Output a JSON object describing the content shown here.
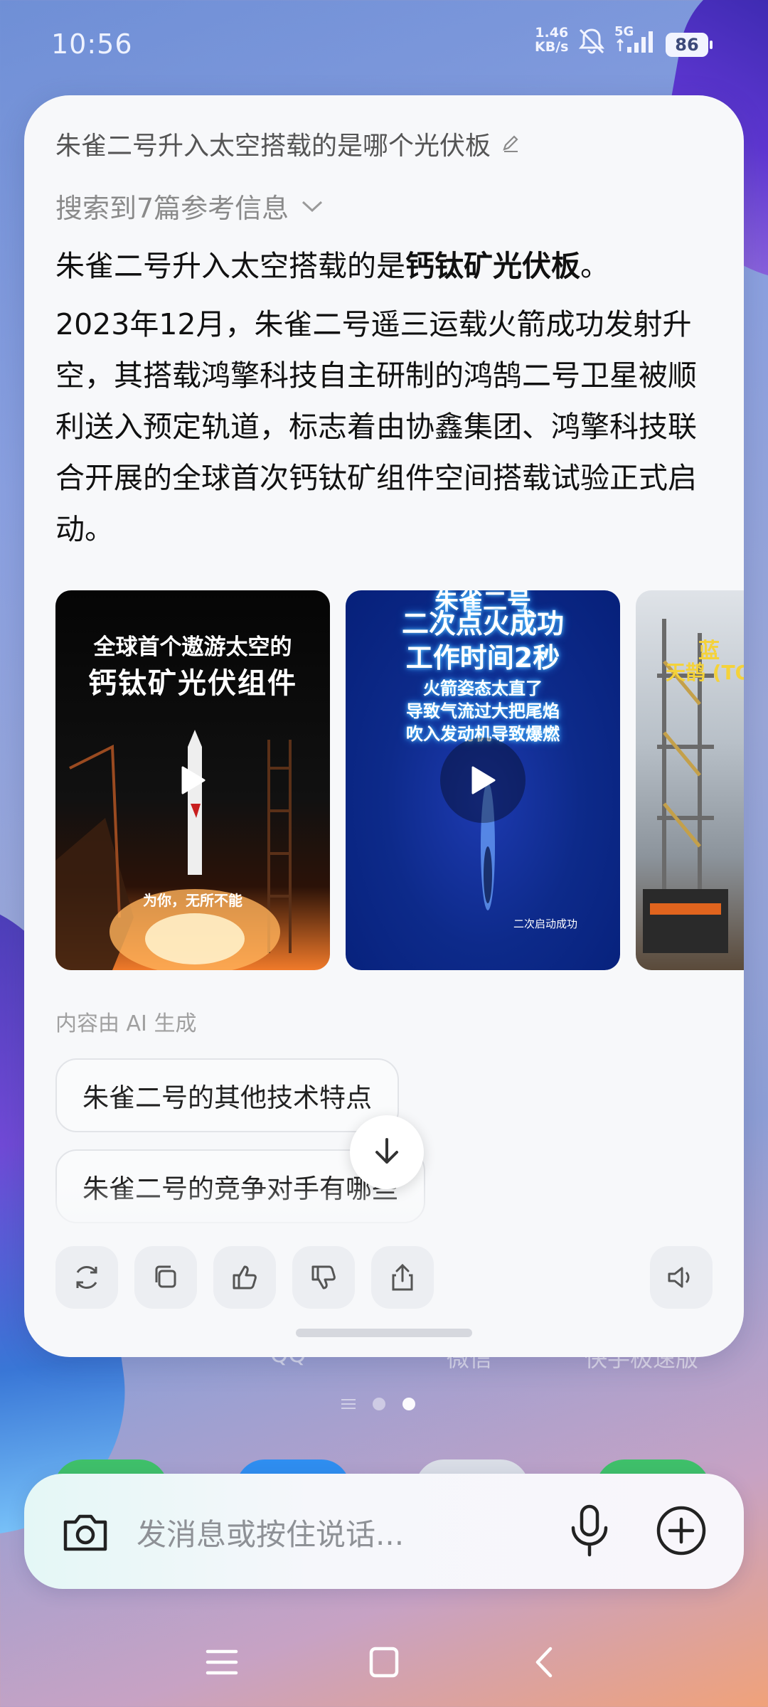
{
  "status_bar": {
    "time": "10:56",
    "net_speed_value": "1.46",
    "net_speed_unit": "KB/s",
    "network": "5G",
    "battery": "86"
  },
  "card": {
    "question": "朱雀二号升入太空搭载的是哪个光伏板",
    "search_refs": "搜索到7篇参考信息",
    "answer_lead_prefix": "朱雀二号升入太空搭载的是",
    "answer_lead_bold": "钙钛矿光伏板",
    "answer_lead_suffix": "。",
    "answer_body": "2023年12月，朱雀二号遥三运载火箭成功发射升空，其搭载鸿擎科技自主研制的鸿鹄二号卫星被顺利送入预定轨道，标志着由协鑫集团、鸿擎科技联合开展的全球首次钙钛矿组件空间搭载试验正式启动。",
    "videos": [
      {
        "title_line1": "全球首个遨游太空的",
        "title_line2": "钙钛矿光伏组件",
        "caption": "为你，无所不能"
      },
      {
        "top_text": "朱雀二号",
        "title_line1": "二次点火成功",
        "title_line2": "工作时间2秒",
        "sub_line1": "火箭姿态太直了",
        "sub_line2": "导致气流过大把尾焰",
        "sub_line3": "吹入发动机导致爆燃",
        "caption": "二次启动成功"
      },
      {
        "title": "天鹊 (TQ",
        "tag": "蓝"
      }
    ],
    "ai_note": "内容由 AI 生成",
    "suggestions": [
      "朱雀二号的其他技术特点",
      "朱雀二号的竞争对手有哪些"
    ],
    "actions": [
      "refresh-icon",
      "copy-icon",
      "thumbs-up-icon",
      "thumbs-down-icon",
      "share-icon",
      "speaker-icon"
    ]
  },
  "home": {
    "labels": [
      "QQ",
      "微信",
      "快手极速版"
    ]
  },
  "input": {
    "placeholder": "发消息或按住说话..."
  },
  "colors": {
    "card_bg": "#f7f8fa",
    "text_primary": "#111111",
    "text_muted": "#8a8a8a"
  }
}
